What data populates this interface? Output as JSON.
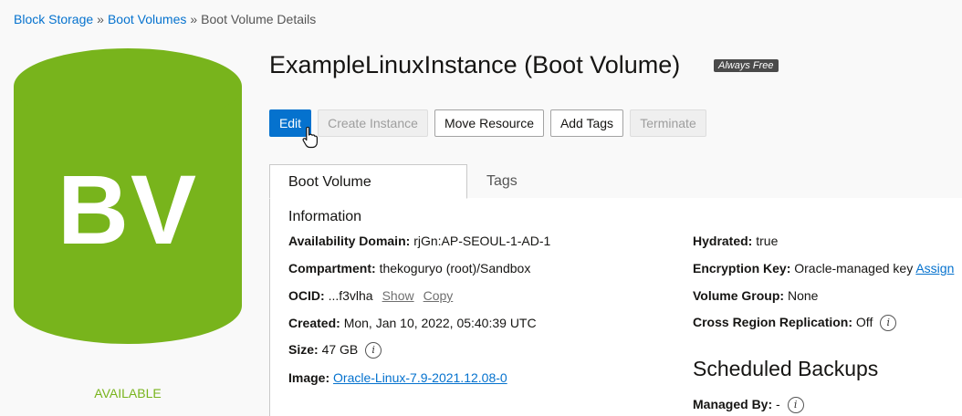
{
  "breadcrumb": {
    "items": [
      "Block Storage",
      "Boot Volumes",
      "Boot Volume Details"
    ],
    "separator": "»"
  },
  "resource_icon": {
    "abbr": "BV",
    "status": "AVAILABLE",
    "color": "#78b41c"
  },
  "header": {
    "title": "ExampleLinuxInstance (Boot Volume)",
    "badge": "Always Free"
  },
  "toolbar": {
    "edit": "Edit",
    "create_instance": "Create Instance",
    "move_resource": "Move Resource",
    "add_tags": "Add Tags",
    "terminate": "Terminate"
  },
  "tabs": [
    "Boot Volume Information",
    "Tags"
  ],
  "details_left": {
    "availability_domain": {
      "label": "Availability Domain:",
      "value": "rjGn:AP-SEOUL-1-AD-1"
    },
    "compartment": {
      "label": "Compartment:",
      "value": "thekoguryo (root)/Sandbox"
    },
    "ocid": {
      "label": "OCID:",
      "value": "...f3vlha",
      "show": "Show",
      "copy": "Copy"
    },
    "created": {
      "label": "Created:",
      "value": "Mon, Jan 10, 2022, 05:40:39 UTC"
    },
    "size": {
      "label": "Size:",
      "value": "47 GB"
    },
    "image": {
      "label": "Image:",
      "value": "Oracle-Linux-7.9-2021.12.08-0"
    }
  },
  "details_right": {
    "hydrated": {
      "label": "Hydrated:",
      "value": "true"
    },
    "encryption_key": {
      "label": "Encryption Key:",
      "value": "Oracle-managed key",
      "action": "Assign"
    },
    "volume_group": {
      "label": "Volume Group:",
      "value": "None"
    },
    "cross_region": {
      "label": "Cross Region Replication:",
      "value": "Off"
    }
  },
  "scheduled_backups": {
    "heading": "Scheduled Backups",
    "managed_by": {
      "label": "Managed By:",
      "value": "-"
    }
  },
  "icons": {
    "info": "i",
    "cursor": "hand-pointer-icon"
  },
  "colors": {
    "link": "#0572ce",
    "primary": "#0572ce",
    "available": "#78b41c"
  }
}
